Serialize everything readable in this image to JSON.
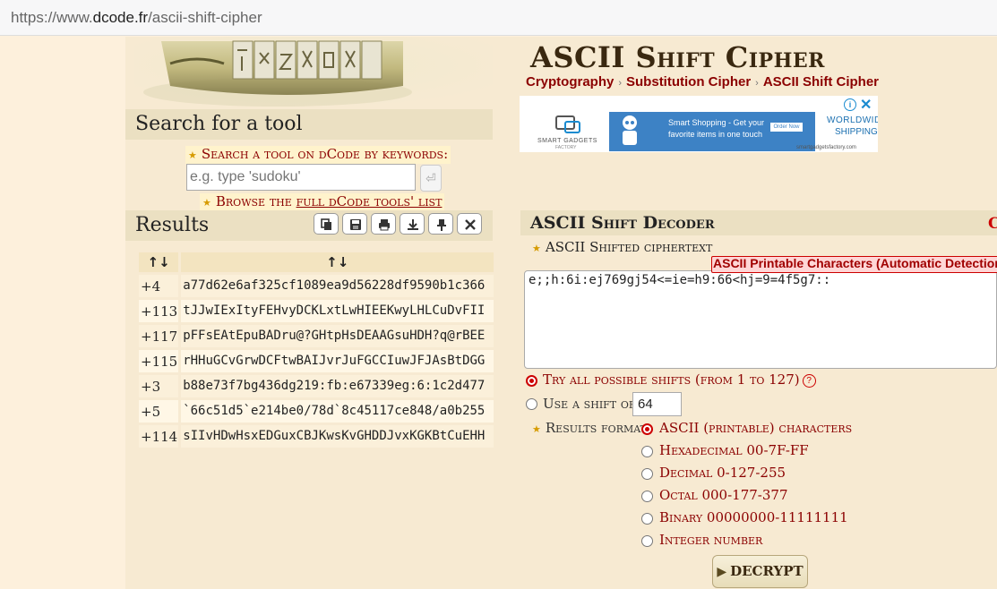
{
  "browser": {
    "url_prefix": "https://www.",
    "url_domain": "dcode.fr",
    "url_path": "/ascii-shift-cipher"
  },
  "search": {
    "title": "Search for a tool",
    "label": "Search a tool on dCode by keywords:",
    "placeholder": "e.g. type 'sudoku'",
    "go_icon": "return-icon",
    "browse_prefix": "Browse the ",
    "browse_link": "full dCode tools' list"
  },
  "results": {
    "title": "Results",
    "toolbar_icons": [
      "copy-icon",
      "save-icon",
      "print-icon",
      "download-icon",
      "pin-icon",
      "close-icon"
    ],
    "columns": [
      "↑↓",
      "↑↓"
    ],
    "rows": [
      {
        "shift": "+4",
        "text": "a77d62e6af325cf1089ea9d56228df9590b1c366"
      },
      {
        "shift": "+113",
        "text": "tJJwIExItyFEHvyDCKLxtLwHIEEKwyLHLCuDvFII"
      },
      {
        "shift": "+117",
        "text": "pFFsEAtEpuBADru@?GHtpHsDEAAGsuHDH?q@rBEE"
      },
      {
        "shift": "+115",
        "text": "rHHuGCvGrwDCFtwBAIJvrJuFGCCIuwJFJAsBtDGG"
      },
      {
        "shift": "+3",
        "text": "b88e73f7bg436dg219:fb:e67339eg:6:1c2d477"
      },
      {
        "shift": "+5",
        "text": "`66c51d5`e214be0/78d`8c45117ce848/a0b255"
      },
      {
        "shift": "+114",
        "text": "sIIvHDwHsxEDGuxCBJKwsKvGHDDJvxKGKBtCuEHH"
      }
    ]
  },
  "page": {
    "title": "ASCII Shift Cipher",
    "breadcrumb": [
      "Cryptography",
      "Substitution Cipher",
      "ASCII Shift Cipher"
    ],
    "breadcrumb_sep": "›"
  },
  "ad": {
    "brand_name": "SMART GADGETS",
    "brand_sub": "FACTORY",
    "banner_line1": "Smart Shopping - Get your",
    "banner_line2": "favorite items in one touch",
    "banner_button": "Order Now",
    "tagline1": "WORLDWIDE",
    "tagline2": "SHIPPING",
    "domain": "smartgadgetsfactory.com",
    "info_icon": "info-icon",
    "close_icon": "close-icon"
  },
  "decoder": {
    "title": "ASCII Shift Decoder",
    "ciphertext_label": "ASCII Shifted ciphertext",
    "detection_badge": "ASCII Printable Characters (Automatic Detection)",
    "ciphertext": "e;;h:6i:ej769gj54<=ie=h9:66<hj=9=4f5g7::",
    "option_all": "Try all possible shifts (from 1 to 127)",
    "option_shift": "Use a shift of",
    "shift_value": "64",
    "results_format_label": "Results format",
    "formats": [
      "ASCII (printable) characters",
      "Hexadecimal 00-7F-FF",
      "Decimal 0-127-255",
      "Octal 000-177-377",
      "Binary 00000000-11111111",
      "Integer number"
    ],
    "selected_format": 0,
    "decrypt_label": "DECRYPT"
  },
  "colors": {
    "accent": "#8b0000",
    "background": "#f7ead2",
    "title_bar": "#ebe0c2"
  }
}
